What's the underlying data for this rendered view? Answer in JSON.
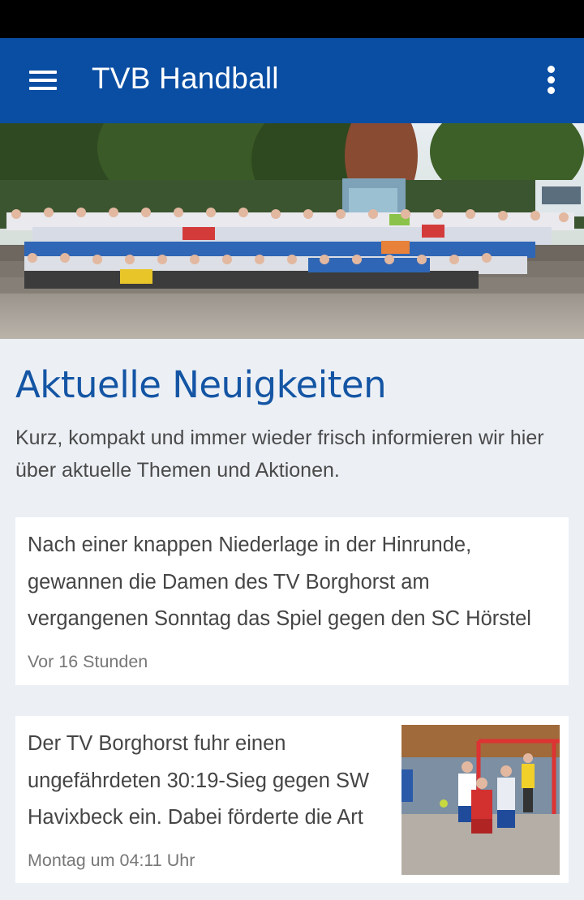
{
  "app_bar": {
    "title": "TVB Handball",
    "menu_icon": "hamburger-menu-icon",
    "overflow_icon": "more-vert-icon",
    "color": "#0a4ea3"
  },
  "hero": {
    "image": "team-group-photo"
  },
  "news": {
    "title": "Aktuelle Neuigkeiten",
    "intro": "Kurz, kompakt und immer wieder frisch informieren wir hier über aktuelle Themen und Aktionen.",
    "items": [
      {
        "text": "Nach einer knappen Niederlage in der Hinrunde, gewannen die Damen des TV Borghorst am vergangenen Sonntag das Spiel gegen den SC Hörstel",
        "time": "Vor 16 Stunden"
      },
      {
        "text": "Der TV Borghorst fuhr einen ungefährdeten 30:19-Sieg gegen SW Havixbeck ein. Dabei förderte die Art",
        "time": "Montag um 04:11 Uhr",
        "thumbnail": "handball-match-photo"
      }
    ]
  },
  "colors": {
    "accent": "#1455a4",
    "background": "#ecf0f5"
  }
}
